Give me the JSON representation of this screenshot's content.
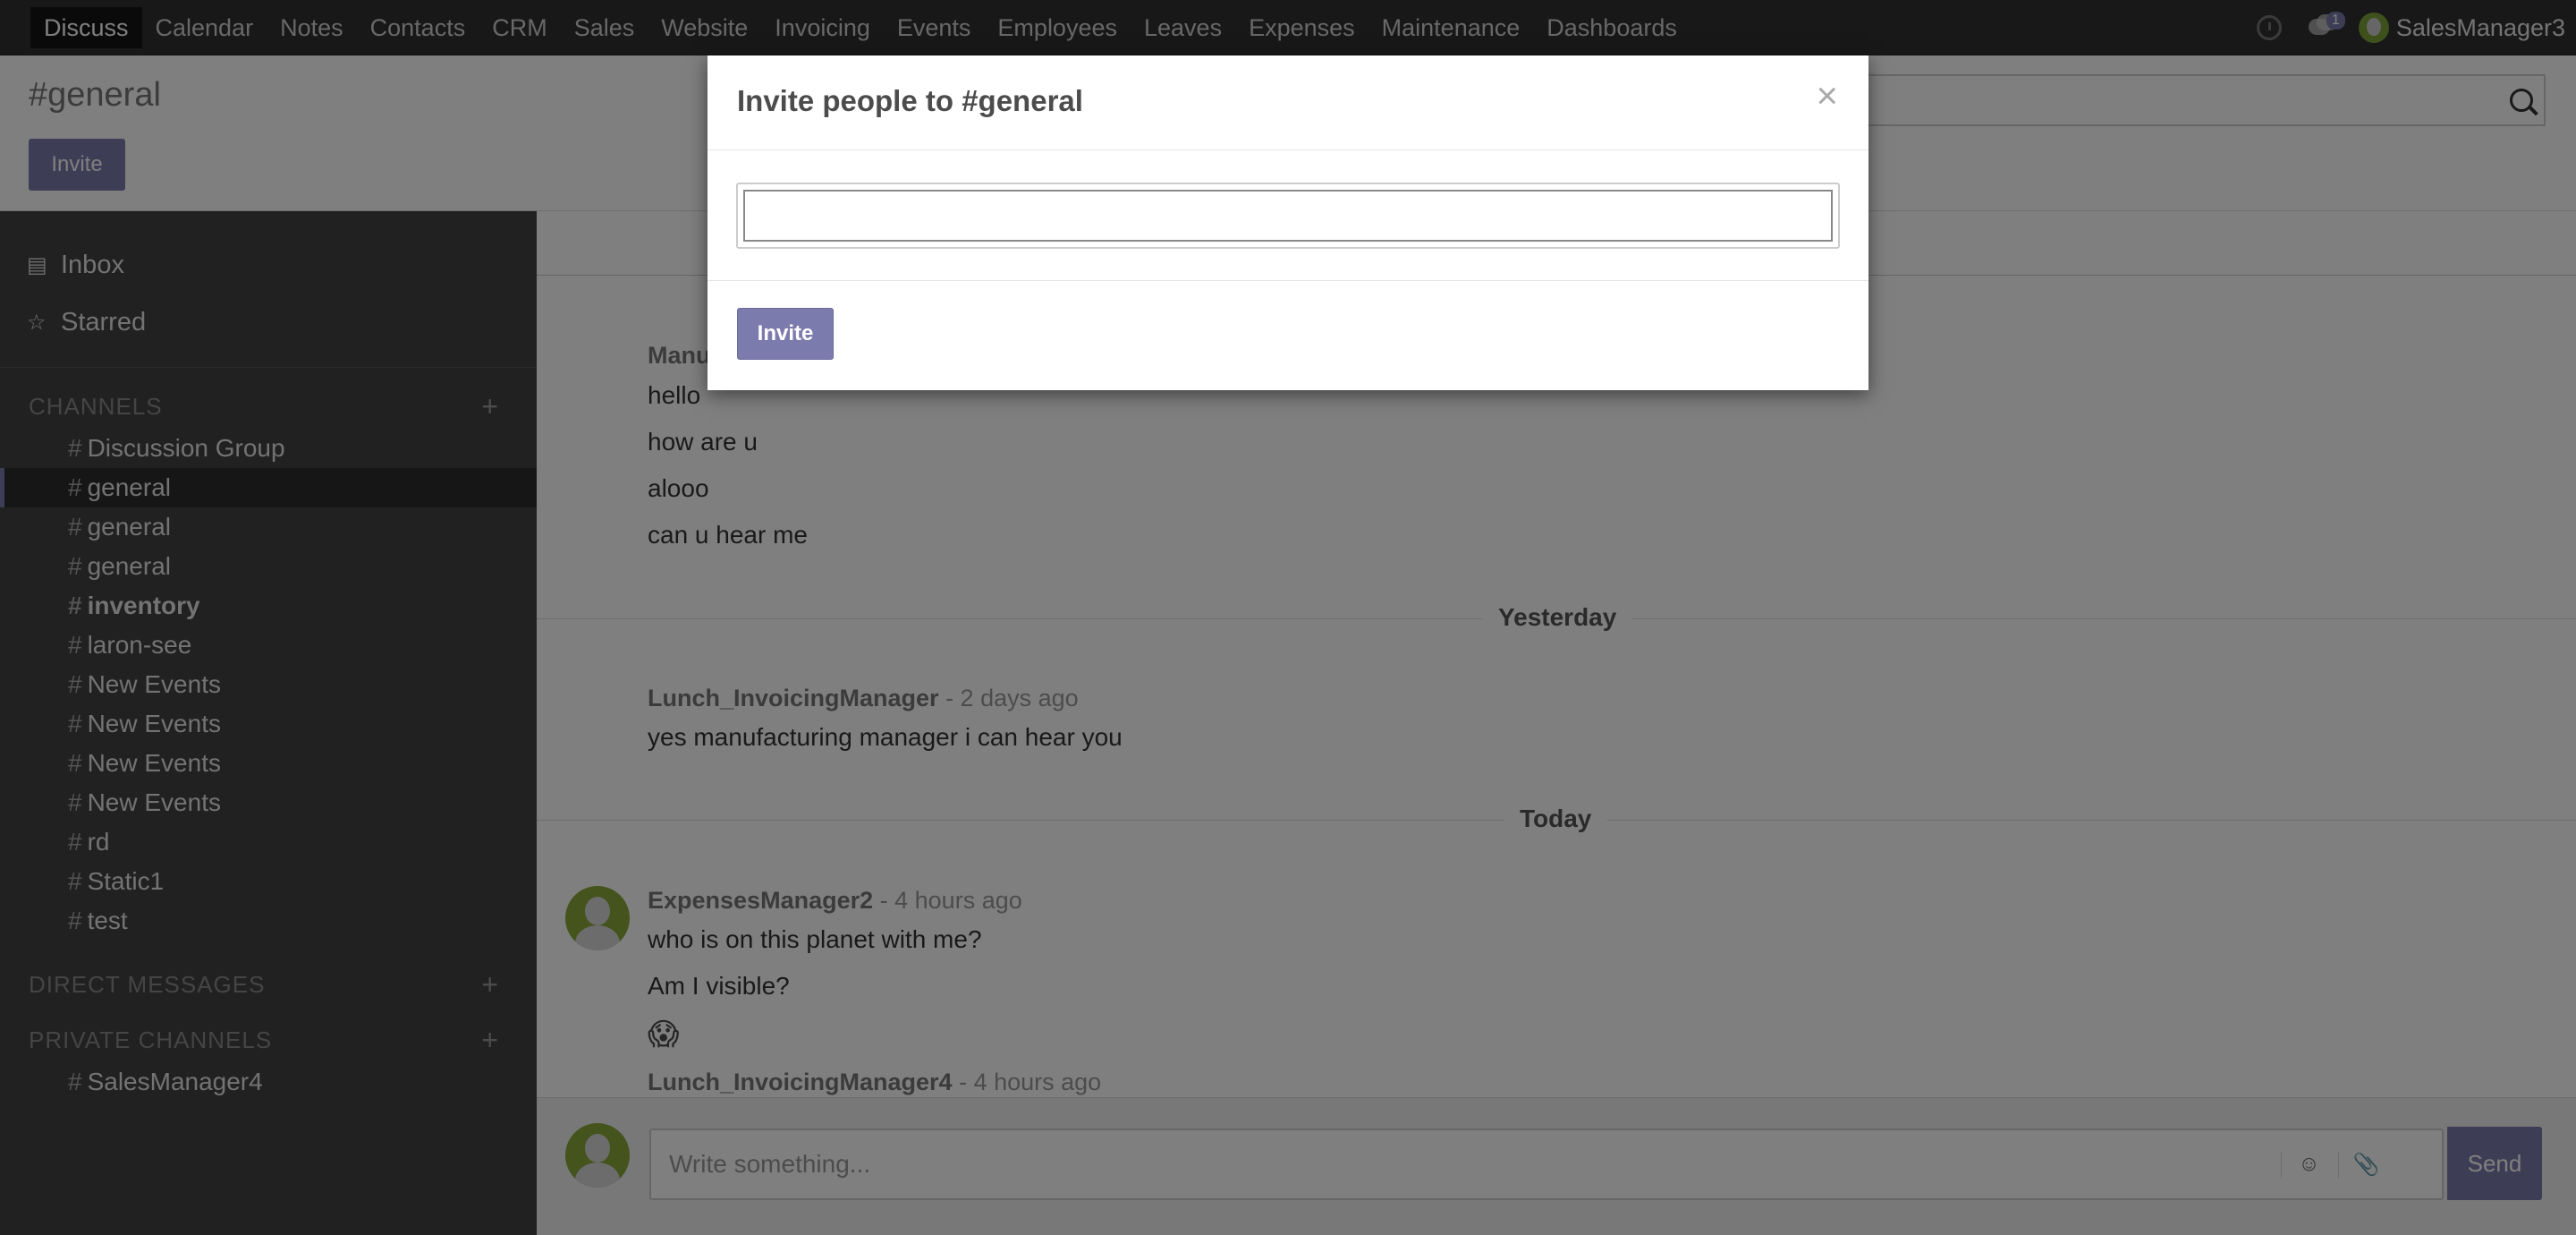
{
  "topnav": {
    "menu": [
      "Discuss",
      "Calendar",
      "Notes",
      "Contacts",
      "CRM",
      "Sales",
      "Website",
      "Invoicing",
      "Events",
      "Employees",
      "Leaves",
      "Expenses",
      "Maintenance",
      "Dashboards"
    ],
    "chat_badge": "1",
    "user": "SalesManager3"
  },
  "cpanel": {
    "title": "#general",
    "invite": "Invite"
  },
  "sidebar": {
    "inbox": "Inbox",
    "starred": "Starred",
    "channels_header": "CHANNELS",
    "channels": [
      "Discussion Group",
      "general",
      "general",
      "general",
      "inventory",
      "laron-see",
      "New Events",
      "New Events",
      "New Events",
      "New Events",
      "rd",
      "Static1",
      "test"
    ],
    "dm_header": "DIRECT MESSAGES",
    "private_header": "PRIVATE CHANNELS",
    "private_channels": [
      "SalesManager4"
    ]
  },
  "thread": {
    "msg_group1": {
      "author_partial": "Manu",
      "lines": [
        "hello",
        "how are u",
        "alooo",
        "can u hear me"
      ]
    },
    "divider_yesterday": "Yesterday",
    "msg_group2": {
      "author": "Lunch_InvoicingManager",
      "when": "- 2 days ago",
      "line": "yes manufacturing manager i can hear you"
    },
    "divider_today": "Today",
    "msg_group3": {
      "author": "ExpensesManager2",
      "when": "- 4 hours ago",
      "lines": [
        "who is on this planet with me?",
        "Am I visible?"
      ],
      "emoji": "😱"
    },
    "msg_group4": {
      "author": "Lunch_InvoicingManager4",
      "when": "- 4 hours ago"
    },
    "composer": {
      "placeholder": "Write something...",
      "send": "Send"
    }
  },
  "modal": {
    "title": "Invite people to #general",
    "close": "×",
    "invite_button": "Invite"
  },
  "colors": {
    "accent": "#7c7bad",
    "navbar": "#303030",
    "sidebar": "#424242"
  }
}
